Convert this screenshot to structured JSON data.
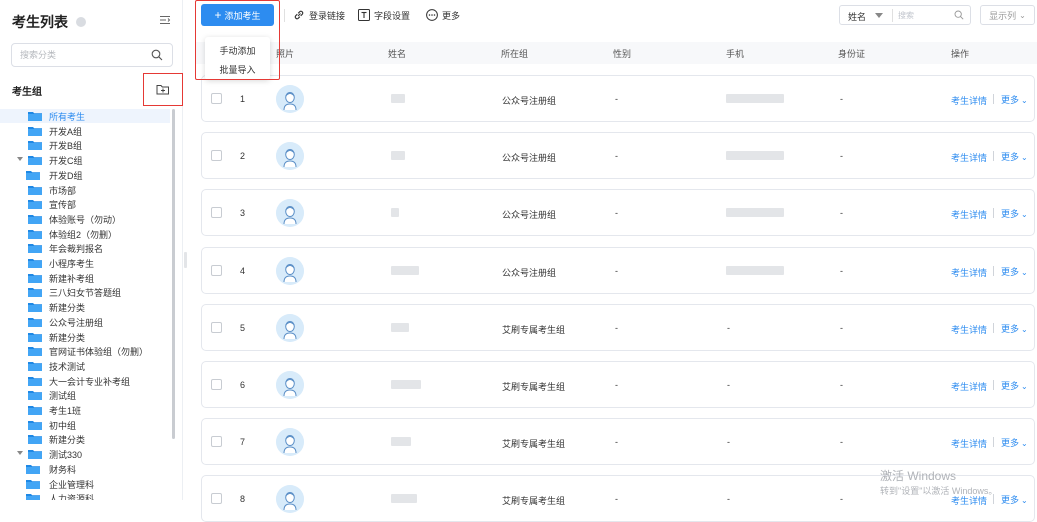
{
  "sidebar": {
    "title": "考生列表",
    "search_placeholder": "搜索分类",
    "group_title": "考生组",
    "tree": [
      {
        "label": "所有考生",
        "level": 1,
        "selected": true
      },
      {
        "label": "开发A组",
        "level": 1
      },
      {
        "label": "开发B组",
        "level": 1
      },
      {
        "label": "开发C组",
        "level": 1,
        "expanded": true
      },
      {
        "label": "开发D组",
        "level": 2
      },
      {
        "label": "市场部",
        "level": 1
      },
      {
        "label": "宣传部",
        "level": 1
      },
      {
        "label": "体验账号（勿动）",
        "level": 1
      },
      {
        "label": "体验组2（勿删）",
        "level": 1
      },
      {
        "label": "年会裁判报名",
        "level": 1
      },
      {
        "label": "小程序考生",
        "level": 1
      },
      {
        "label": "新建补考组",
        "level": 1
      },
      {
        "label": "三八妇女节答题组",
        "level": 1
      },
      {
        "label": "新建分类",
        "level": 1
      },
      {
        "label": "公众号注册组",
        "level": 1
      },
      {
        "label": "新建分类",
        "level": 1
      },
      {
        "label": "官网证书体验组（勿删）",
        "level": 1
      },
      {
        "label": "技术测试",
        "level": 1
      },
      {
        "label": "大一会计专业补考组",
        "level": 1
      },
      {
        "label": "测试组",
        "level": 1
      },
      {
        "label": "考生1班",
        "level": 1
      },
      {
        "label": "初中组",
        "level": 1
      },
      {
        "label": "新建分类",
        "level": 1
      },
      {
        "label": "测试330",
        "level": 1,
        "expanded": true
      },
      {
        "label": "财务科",
        "level": 2
      },
      {
        "label": "企业管理科",
        "level": 2
      },
      {
        "label": "人力资源科",
        "level": 2
      }
    ]
  },
  "toolbar": {
    "add_label": "添加考生",
    "add_menu": [
      "手动添加",
      "批量导入"
    ],
    "login_link_label": "登录链接",
    "fields_label": "字段设置",
    "more_label": "更多",
    "search_field": "姓名",
    "search_placeholder": "搜索",
    "columns_label": "显示列"
  },
  "table": {
    "headers": [
      "照片",
      "姓名",
      "所在组",
      "性别",
      "手机",
      "身份证",
      "操作"
    ],
    "detail_label": "考生详情",
    "more_label": "更多",
    "rows": [
      {
        "index": "1",
        "group": "公众号注册组",
        "gender": "-",
        "phone": "",
        "idcard": "-"
      },
      {
        "index": "2",
        "group": "公众号注册组",
        "gender": "-",
        "phone": "",
        "idcard": "-"
      },
      {
        "index": "3",
        "group": "公众号注册组",
        "gender": "-",
        "phone": "",
        "idcard": "-"
      },
      {
        "index": "4",
        "group": "公众号注册组",
        "gender": "-",
        "phone": "",
        "idcard": "-"
      },
      {
        "index": "5",
        "group": "艾刷专属考生组",
        "gender": "-",
        "phone": "-",
        "idcard": "-"
      },
      {
        "index": "6",
        "group": "艾刷专属考生组",
        "gender": "-",
        "phone": "-",
        "idcard": "-"
      },
      {
        "index": "7",
        "group": "艾刷专属考生组",
        "gender": "-",
        "phone": "-",
        "idcard": "-"
      },
      {
        "index": "8",
        "group": "艾刷专属考生组",
        "gender": "-",
        "phone": "-",
        "idcard": "-"
      }
    ]
  },
  "watermark": {
    "line1": "激活 Windows",
    "line2": "转到\"设置\"以激活 Windows。"
  },
  "colors": {
    "accent": "#2d8cf0",
    "highlight": "#e53935"
  }
}
